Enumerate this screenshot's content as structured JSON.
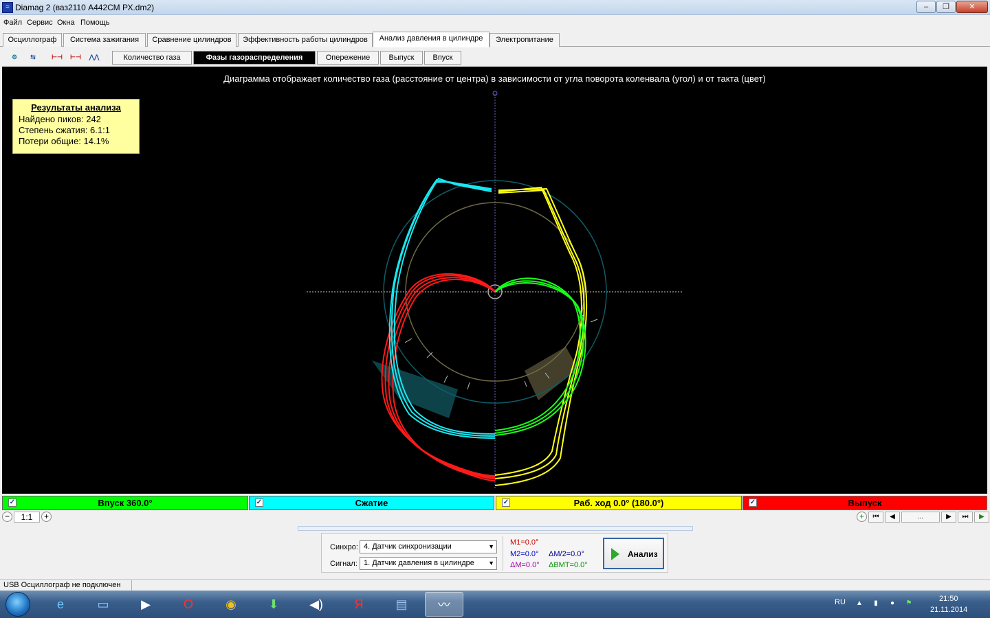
{
  "window": {
    "title": "Diamag 2 (ваз2110  А442СМ РХ.dm2)",
    "app_icon": "oscillogram-icon"
  },
  "menu": [
    "Файл",
    "Сервис",
    "Окна",
    "Помощь"
  ],
  "tabs": [
    {
      "label": "Осциллограф",
      "active": false
    },
    {
      "label": "Система зажигания",
      "active": false
    },
    {
      "label": "Сравнение цилиндров",
      "active": false
    },
    {
      "label": "Эффективность работы цилиндров",
      "active": false
    },
    {
      "label": "Анализ давления в цилиндре",
      "active": true
    },
    {
      "label": "Электропитание",
      "active": false
    }
  ],
  "toolbar_icons": [
    "sync-settings-icon",
    "numbering-icon",
    "cursor-markers-icon",
    "auto-markers-icon",
    "waveform-icon"
  ],
  "subtabs": [
    {
      "label": "Количество газа",
      "active": false
    },
    {
      "label": "Фазы газораспределения",
      "active": true
    },
    {
      "label": "Опережение",
      "active": false
    },
    {
      "label": "Выпуск",
      "active": false
    },
    {
      "label": "Впуск",
      "active": false
    }
  ],
  "diagram": {
    "caption": "Диаграмма отображает количество газа (расстояние от центра) в зависимости от угла поворота коленвала (угол) и от такта (цвет)",
    "colors": {
      "intake": "#1aff1a",
      "compression": "#1ae6f0",
      "power": "#ffff1a",
      "exhaust": "#ff1a1a",
      "ring_outer": "#0f5c66",
      "ring_inner": "#6d6a45",
      "axis": "#7a5ccc"
    }
  },
  "results": {
    "title": "Результаты анализа",
    "peaks": "Найдено пиков: 242",
    "compression": "Степень сжатия: 6.1:1",
    "losses": "Потери общие: 14.1%"
  },
  "phases": [
    {
      "label": "Впуск 360.0°",
      "color": "#00ff00",
      "checked": true
    },
    {
      "label": "Сжатие",
      "color": "#00ffff",
      "checked": true
    },
    {
      "label": "Раб. ход 0.0° (180.0°)",
      "color": "#ffff00",
      "checked": true
    },
    {
      "label": "Выпуск",
      "color": "#ff0000",
      "checked": true
    }
  ],
  "zoom": {
    "label": "1:1"
  },
  "nav": {
    "dots": "..."
  },
  "controls": {
    "sync_label": "Синхро:",
    "sync_value": "4.  Датчик синхронизации",
    "signal_label": "Сигнал:",
    "signal_value": "1.  Датчик давления в цилиндре",
    "m1": "M1=0.0°",
    "m2": "M2=0.0°",
    "dm2": "ΔM/2=0.0°",
    "dm": "ΔM=0.0°",
    "dbmt": "ΔBMT=0.0°",
    "analyze": "Анализ"
  },
  "status": {
    "text": "USB Осциллограф не подключен"
  },
  "taskbar": {
    "apps": [
      "start-orb",
      "ie-icon",
      "explorer-icon",
      "media-player-icon",
      "opera-icon",
      "chrome-icon",
      "download-icon",
      "speaker-icon",
      "yandex-icon",
      "files-icon",
      "diamag-icon"
    ],
    "lang": "RU",
    "time": "21:50",
    "date": "21.11.2014"
  }
}
